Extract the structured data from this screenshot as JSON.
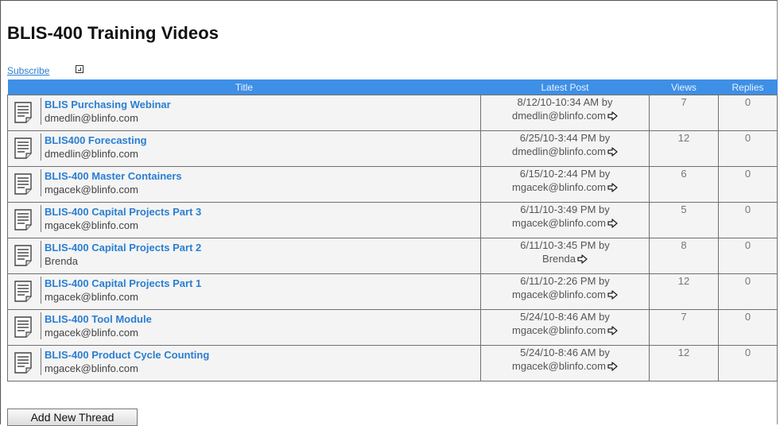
{
  "page": {
    "title": "BLIS-400 Training Videos",
    "subscribe_label": "Subscribe",
    "add_button_label": "Add New Thread"
  },
  "table": {
    "headers": {
      "title": "Title",
      "latest_post": "Latest Post",
      "views": "Views",
      "replies": "Replies"
    },
    "rows": [
      {
        "title": "BLIS Purchasing Webinar",
        "author": "dmedlin@blinfo.com",
        "latest_date": "8/12/10-10:34 AM by",
        "latest_by": "dmedlin@blinfo.com",
        "views": "7",
        "replies": "0"
      },
      {
        "title": "BLIS400 Forecasting",
        "author": "dmedlin@blinfo.com",
        "latest_date": "6/25/10-3:44 PM by",
        "latest_by": "dmedlin@blinfo.com",
        "views": "12",
        "replies": "0"
      },
      {
        "title": "BLIS-400 Master Containers",
        "author": "mgacek@blinfo.com",
        "latest_date": "6/15/10-2:44 PM by",
        "latest_by": "mgacek@blinfo.com",
        "views": "6",
        "replies": "0"
      },
      {
        "title": "BLIS-400 Capital Projects Part 3",
        "author": "mgacek@blinfo.com",
        "latest_date": "6/11/10-3:49 PM by",
        "latest_by": "mgacek@blinfo.com",
        "views": "5",
        "replies": "0"
      },
      {
        "title": "BLIS-400 Capital Projects Part 2",
        "author": "Brenda",
        "latest_date": "6/11/10-3:45 PM by",
        "latest_by": "Brenda",
        "views": "8",
        "replies": "0"
      },
      {
        "title": "BLIS-400 Capital Projects Part 1",
        "author": "mgacek@blinfo.com",
        "latest_date": "6/11/10-2:26 PM by",
        "latest_by": "mgacek@blinfo.com",
        "views": "12",
        "replies": "0"
      },
      {
        "title": "BLIS-400 Tool Module",
        "author": "mgacek@blinfo.com",
        "latest_date": "5/24/10-8:46 AM by",
        "latest_by": "mgacek@blinfo.com",
        "views": "7",
        "replies": "0"
      },
      {
        "title": "BLIS-400 Product Cycle Counting",
        "author": "mgacek@blinfo.com",
        "latest_date": "5/24/10-8:46 AM by",
        "latest_by": "mgacek@blinfo.com",
        "views": "12",
        "replies": "0"
      }
    ]
  },
  "icons": {
    "thread": "document-icon",
    "go_to_post": "arrow-right-icon",
    "subscribe": "subscribe-help-icon"
  },
  "colors": {
    "header_bg": "#3e8fe6",
    "link": "#2a7ed1",
    "row_bg": "#f4f4f4"
  }
}
